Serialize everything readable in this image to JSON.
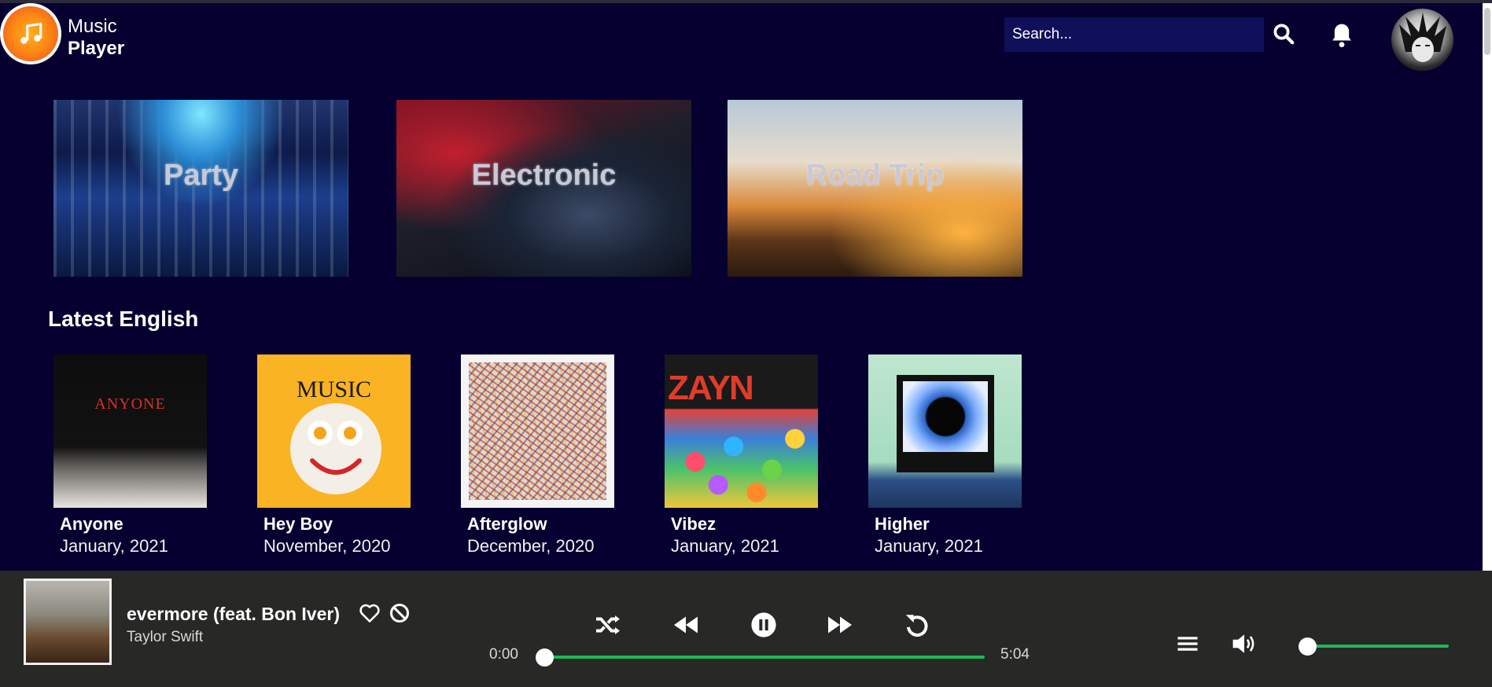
{
  "app": {
    "logo_line1": "Music",
    "logo_line2": "Player"
  },
  "header": {
    "search_placeholder": "Search..."
  },
  "genres": [
    {
      "label": "Party"
    },
    {
      "label": "Electronic"
    },
    {
      "label": "Road Trip"
    }
  ],
  "section": {
    "title": "Latest English"
  },
  "albums": [
    {
      "title": "Anyone",
      "date": "January, 2021",
      "cover_text": "ANYONE"
    },
    {
      "title": "Hey Boy",
      "date": "November, 2020",
      "cover_text": "MUSIC"
    },
    {
      "title": "Afterglow",
      "date": "December, 2020"
    },
    {
      "title": "Vibez",
      "date": "January, 2021",
      "cover_text": "ZAYN"
    },
    {
      "title": "Higher",
      "date": "January, 2021"
    }
  ],
  "now_playing": {
    "title": "evermore (feat. Bon Iver)",
    "artist": "Taylor Swift",
    "current_time": "0:00",
    "total_time": "5:04",
    "progress_fraction": 0.0,
    "volume_fraction": 0.0
  },
  "colors": {
    "background": "#05002f",
    "player_bar": "#282826",
    "accent_green": "#1db954",
    "logo_orange": "#ff8a14",
    "search_bg": "#0f0f5a"
  },
  "icons": {
    "search": "search-icon",
    "notifications": "bell-icon",
    "favorite": "heart-icon",
    "block": "ban-icon",
    "shuffle": "shuffle-icon",
    "previous": "rewind-icon",
    "pause": "pause-icon",
    "next": "fast-forward-icon",
    "repeat": "repeat-icon",
    "queue": "queue-icon",
    "volume": "volume-icon"
  }
}
